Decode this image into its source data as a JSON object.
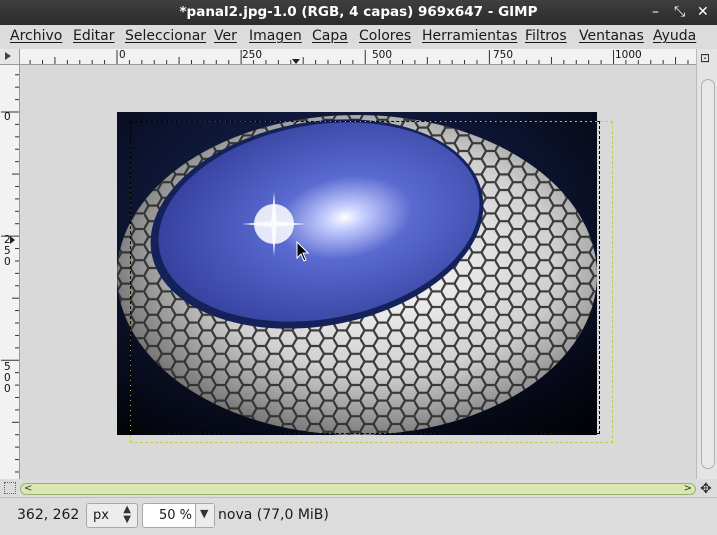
{
  "window": {
    "title": "*panal2.jpg-1.0 (RGB, 4 capas) 969x647 - GIMP",
    "minimize_glyph": "–",
    "maximize_glyph": "⤡",
    "close_glyph": "✕"
  },
  "menubar": [
    "Archivo",
    "Editar",
    "Seleccionar",
    "Ver",
    "Imagen",
    "Capa",
    "Colores",
    "Herramientas",
    "Filtros",
    "Ventanas",
    "Ayuda"
  ],
  "rulers": {
    "horizontal": [
      "0",
      "250",
      "500",
      "750",
      "1000"
    ],
    "vertical": [
      [
        "0"
      ],
      [
        "2",
        "5",
        "0"
      ],
      [
        "5",
        "0",
        "0"
      ]
    ]
  },
  "image": {
    "description_icons": [
      "blue-sky-orb",
      "hexagon-egg",
      "sparkle-light"
    ]
  },
  "statusbar": {
    "coords": "362, 262",
    "unit": "px",
    "zoom": "50",
    "zoom_unit": "%",
    "message": "nova (77,0 MiB)"
  },
  "colors": {
    "selection_dash": "#ffffff",
    "layer_boundary": "#c8c84a",
    "scrollbar": "#d8e8b0"
  }
}
